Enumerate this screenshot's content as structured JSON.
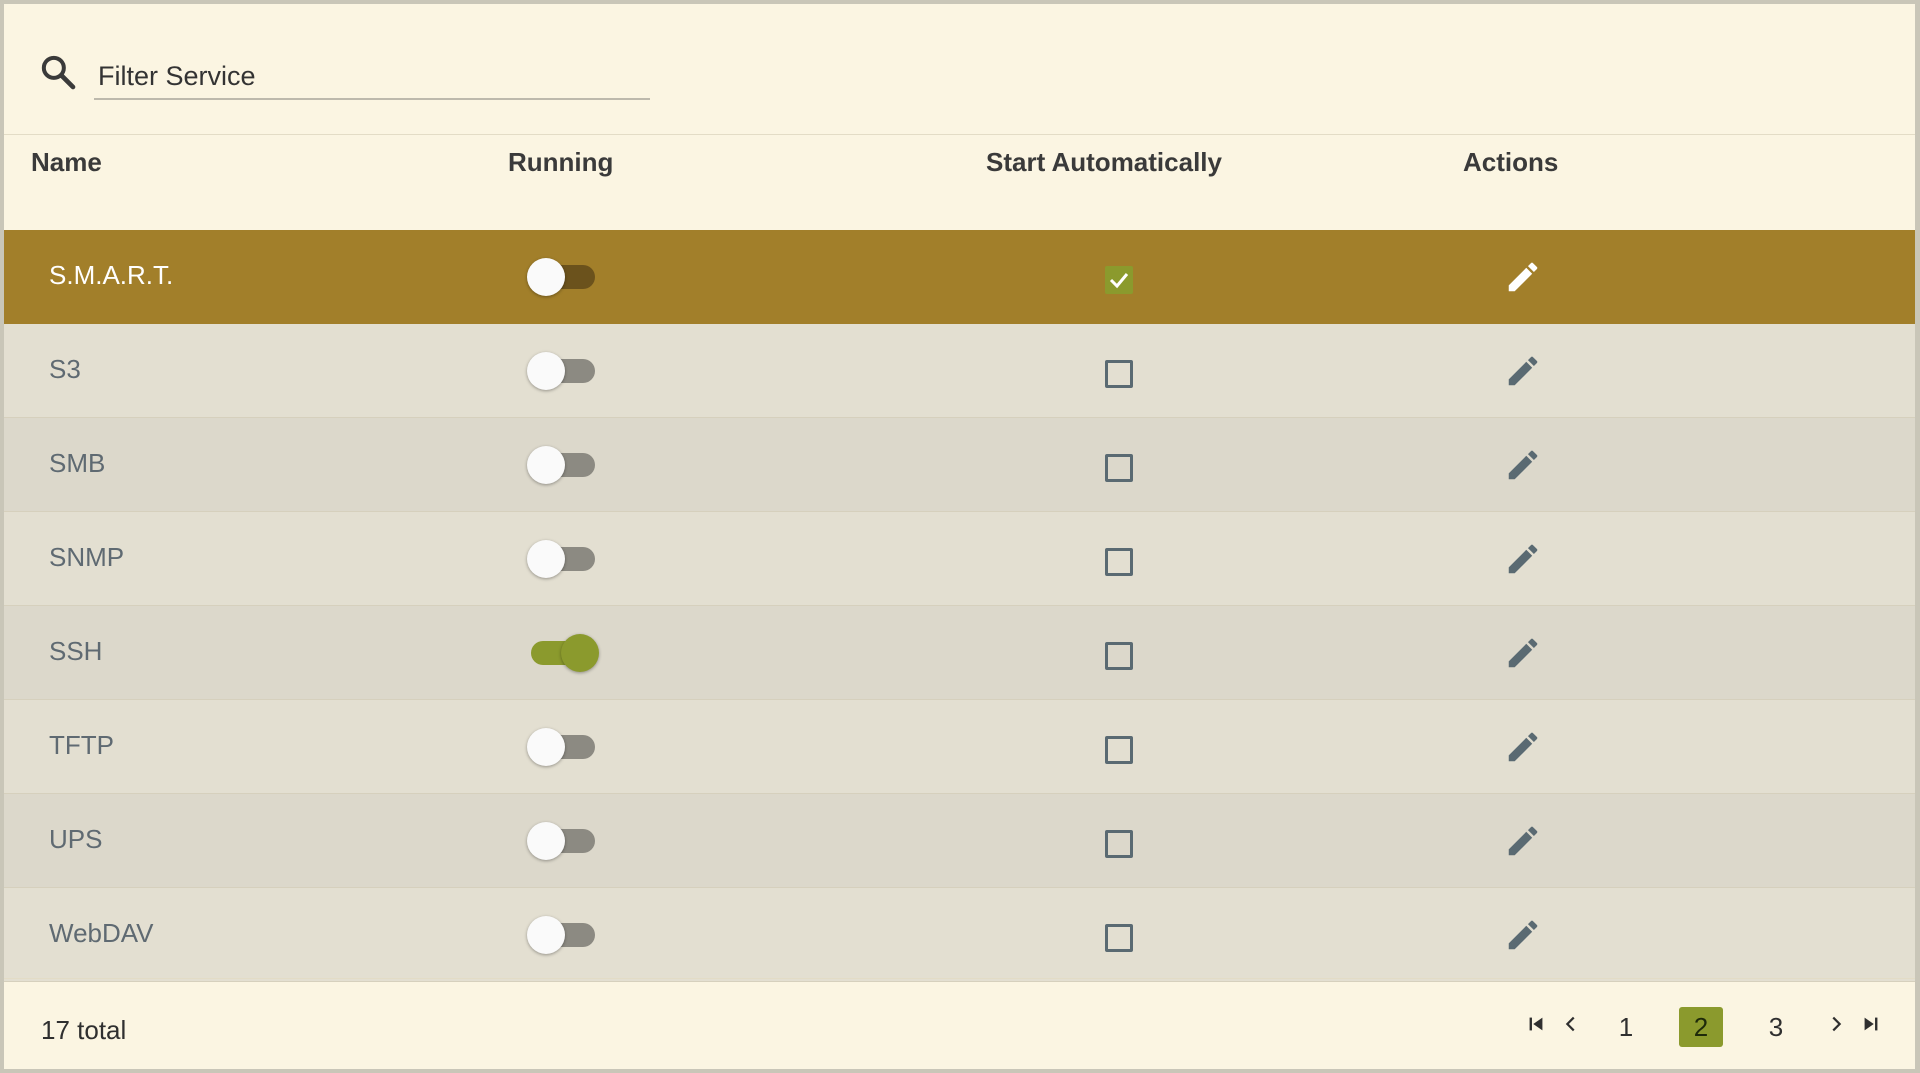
{
  "filter": {
    "placeholder": "Filter Service",
    "value": ""
  },
  "table": {
    "columns": [
      "Name",
      "Running",
      "Start Automatically",
      "Actions"
    ],
    "rows": [
      {
        "name": "S.M.A.R.T.",
        "running": false,
        "start_automatically": true,
        "selected": true
      },
      {
        "name": "S3",
        "running": false,
        "start_automatically": false,
        "selected": false
      },
      {
        "name": "SMB",
        "running": false,
        "start_automatically": false,
        "selected": false
      },
      {
        "name": "SNMP",
        "running": false,
        "start_automatically": false,
        "selected": false
      },
      {
        "name": "SSH",
        "running": true,
        "start_automatically": false,
        "selected": false
      },
      {
        "name": "TFTP",
        "running": false,
        "start_automatically": false,
        "selected": false
      },
      {
        "name": "UPS",
        "running": false,
        "start_automatically": false,
        "selected": false
      },
      {
        "name": "WebDAV",
        "running": false,
        "start_automatically": false,
        "selected": false
      }
    ]
  },
  "footer": {
    "total_label": "17 total",
    "pages": [
      "1",
      "2",
      "3"
    ],
    "current_page": "2"
  },
  "icons": {
    "search": "search-icon",
    "edit": "pencil-icon",
    "first_page": "first-page-icon",
    "prev_page": "chevron-left-icon",
    "next_page": "chevron-right-icon",
    "last_page": "last-page-icon"
  },
  "colors": {
    "selected_row": "#a27f2a",
    "accent_green": "#8b9a2d",
    "panel_bg": "#fbf5e2"
  }
}
